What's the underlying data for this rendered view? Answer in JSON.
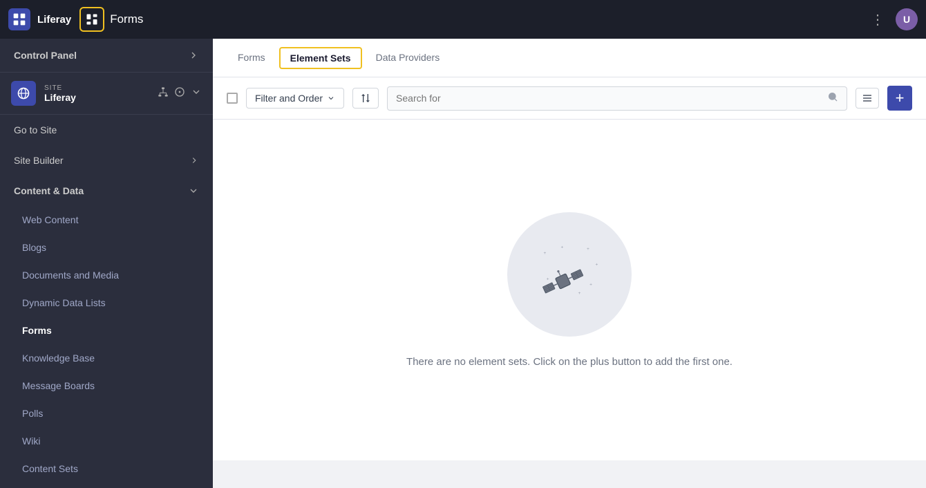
{
  "app": {
    "title": "Liferay",
    "module_title": "Forms"
  },
  "sidebar": {
    "control_panel_label": "Control Panel",
    "site_label": "SITE",
    "site_name": "Liferay",
    "nav_items": [
      {
        "id": "go-to-site",
        "label": "Go to Site",
        "has_arrow": false
      },
      {
        "id": "site-builder",
        "label": "Site Builder",
        "has_arrow": true
      }
    ],
    "content_data_label": "Content & Data",
    "sub_items": [
      {
        "id": "web-content",
        "label": "Web Content",
        "active": false
      },
      {
        "id": "blogs",
        "label": "Blogs",
        "active": false
      },
      {
        "id": "documents-and-media",
        "label": "Documents and Media",
        "active": false
      },
      {
        "id": "dynamic-data-lists",
        "label": "Dynamic Data Lists",
        "active": false
      },
      {
        "id": "forms",
        "label": "Forms",
        "active": true
      },
      {
        "id": "knowledge-base",
        "label": "Knowledge Base",
        "active": false
      },
      {
        "id": "message-boards",
        "label": "Message Boards",
        "active": false
      },
      {
        "id": "polls",
        "label": "Polls",
        "active": false
      },
      {
        "id": "wiki",
        "label": "Wiki",
        "active": false
      },
      {
        "id": "content-sets",
        "label": "Content Sets",
        "active": false
      }
    ]
  },
  "tabs": [
    {
      "id": "forms-tab",
      "label": "Forms",
      "active": false
    },
    {
      "id": "element-sets-tab",
      "label": "Element Sets",
      "active": true
    },
    {
      "id": "data-providers-tab",
      "label": "Data Providers",
      "active": false
    }
  ],
  "toolbar": {
    "filter_label": "Filter and Order",
    "search_placeholder": "Search for",
    "add_button_label": "+"
  },
  "empty_state": {
    "message": "There are no element sets. Click on the plus button to add the first one."
  },
  "icons": {
    "chevron_right": "›",
    "chevron_down": "⌄",
    "dots": "⋮",
    "sort": "⇅",
    "search": "🔍",
    "list_view": "☰",
    "add": "+"
  }
}
